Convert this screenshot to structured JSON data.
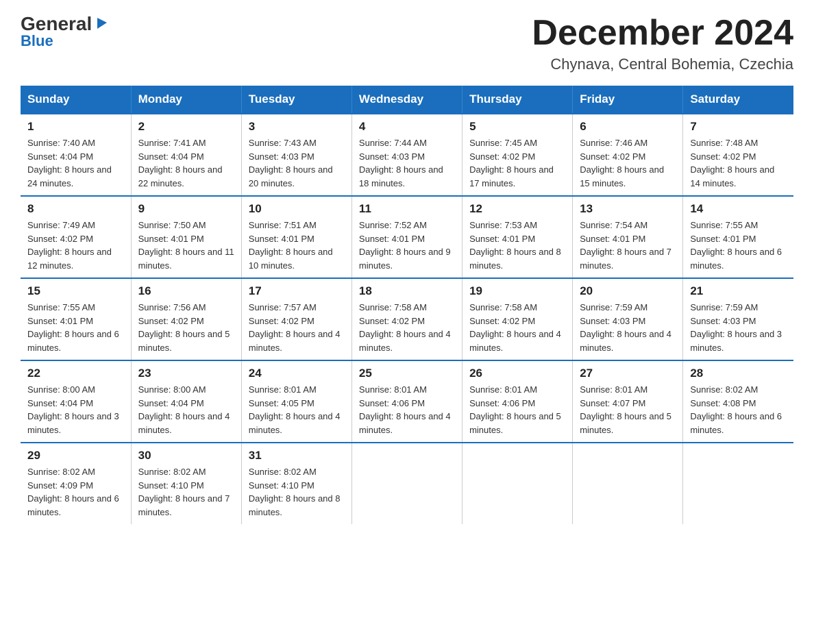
{
  "header": {
    "logo_general": "General",
    "logo_blue": "Blue",
    "main_title": "December 2024",
    "subtitle": "Chynava, Central Bohemia, Czechia"
  },
  "weekdays": [
    "Sunday",
    "Monday",
    "Tuesday",
    "Wednesday",
    "Thursday",
    "Friday",
    "Saturday"
  ],
  "weeks": [
    [
      {
        "day": "1",
        "sunrise": "7:40 AM",
        "sunset": "4:04 PM",
        "daylight": "8 hours and 24 minutes."
      },
      {
        "day": "2",
        "sunrise": "7:41 AM",
        "sunset": "4:04 PM",
        "daylight": "8 hours and 22 minutes."
      },
      {
        "day": "3",
        "sunrise": "7:43 AM",
        "sunset": "4:03 PM",
        "daylight": "8 hours and 20 minutes."
      },
      {
        "day": "4",
        "sunrise": "7:44 AM",
        "sunset": "4:03 PM",
        "daylight": "8 hours and 18 minutes."
      },
      {
        "day": "5",
        "sunrise": "7:45 AM",
        "sunset": "4:02 PM",
        "daylight": "8 hours and 17 minutes."
      },
      {
        "day": "6",
        "sunrise": "7:46 AM",
        "sunset": "4:02 PM",
        "daylight": "8 hours and 15 minutes."
      },
      {
        "day": "7",
        "sunrise": "7:48 AM",
        "sunset": "4:02 PM",
        "daylight": "8 hours and 14 minutes."
      }
    ],
    [
      {
        "day": "8",
        "sunrise": "7:49 AM",
        "sunset": "4:02 PM",
        "daylight": "8 hours and 12 minutes."
      },
      {
        "day": "9",
        "sunrise": "7:50 AM",
        "sunset": "4:01 PM",
        "daylight": "8 hours and 11 minutes."
      },
      {
        "day": "10",
        "sunrise": "7:51 AM",
        "sunset": "4:01 PM",
        "daylight": "8 hours and 10 minutes."
      },
      {
        "day": "11",
        "sunrise": "7:52 AM",
        "sunset": "4:01 PM",
        "daylight": "8 hours and 9 minutes."
      },
      {
        "day": "12",
        "sunrise": "7:53 AM",
        "sunset": "4:01 PM",
        "daylight": "8 hours and 8 minutes."
      },
      {
        "day": "13",
        "sunrise": "7:54 AM",
        "sunset": "4:01 PM",
        "daylight": "8 hours and 7 minutes."
      },
      {
        "day": "14",
        "sunrise": "7:55 AM",
        "sunset": "4:01 PM",
        "daylight": "8 hours and 6 minutes."
      }
    ],
    [
      {
        "day": "15",
        "sunrise": "7:55 AM",
        "sunset": "4:01 PM",
        "daylight": "8 hours and 6 minutes."
      },
      {
        "day": "16",
        "sunrise": "7:56 AM",
        "sunset": "4:02 PM",
        "daylight": "8 hours and 5 minutes."
      },
      {
        "day": "17",
        "sunrise": "7:57 AM",
        "sunset": "4:02 PM",
        "daylight": "8 hours and 4 minutes."
      },
      {
        "day": "18",
        "sunrise": "7:58 AM",
        "sunset": "4:02 PM",
        "daylight": "8 hours and 4 minutes."
      },
      {
        "day": "19",
        "sunrise": "7:58 AM",
        "sunset": "4:02 PM",
        "daylight": "8 hours and 4 minutes."
      },
      {
        "day": "20",
        "sunrise": "7:59 AM",
        "sunset": "4:03 PM",
        "daylight": "8 hours and 4 minutes."
      },
      {
        "day": "21",
        "sunrise": "7:59 AM",
        "sunset": "4:03 PM",
        "daylight": "8 hours and 3 minutes."
      }
    ],
    [
      {
        "day": "22",
        "sunrise": "8:00 AM",
        "sunset": "4:04 PM",
        "daylight": "8 hours and 3 minutes."
      },
      {
        "day": "23",
        "sunrise": "8:00 AM",
        "sunset": "4:04 PM",
        "daylight": "8 hours and 4 minutes."
      },
      {
        "day": "24",
        "sunrise": "8:01 AM",
        "sunset": "4:05 PM",
        "daylight": "8 hours and 4 minutes."
      },
      {
        "day": "25",
        "sunrise": "8:01 AM",
        "sunset": "4:06 PM",
        "daylight": "8 hours and 4 minutes."
      },
      {
        "day": "26",
        "sunrise": "8:01 AM",
        "sunset": "4:06 PM",
        "daylight": "8 hours and 5 minutes."
      },
      {
        "day": "27",
        "sunrise": "8:01 AM",
        "sunset": "4:07 PM",
        "daylight": "8 hours and 5 minutes."
      },
      {
        "day": "28",
        "sunrise": "8:02 AM",
        "sunset": "4:08 PM",
        "daylight": "8 hours and 6 minutes."
      }
    ],
    [
      {
        "day": "29",
        "sunrise": "8:02 AM",
        "sunset": "4:09 PM",
        "daylight": "8 hours and 6 minutes."
      },
      {
        "day": "30",
        "sunrise": "8:02 AM",
        "sunset": "4:10 PM",
        "daylight": "8 hours and 7 minutes."
      },
      {
        "day": "31",
        "sunrise": "8:02 AM",
        "sunset": "4:10 PM",
        "daylight": "8 hours and 8 minutes."
      },
      null,
      null,
      null,
      null
    ]
  ]
}
